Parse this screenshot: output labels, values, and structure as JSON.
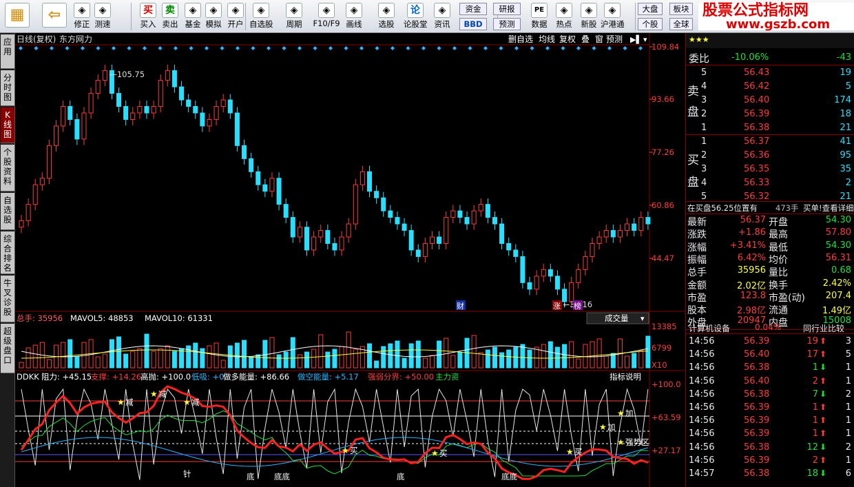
{
  "toolbar": {
    "buttons": [
      {
        "label": "修正",
        "icon": "up-arrow-icon"
      },
      {
        "label": "测速",
        "icon": "clock-icon"
      },
      {
        "label": "买入",
        "icon": "buy-icon",
        "glyph": "买"
      },
      {
        "label": "卖出",
        "icon": "sell-icon",
        "glyph": "卖"
      },
      {
        "label": "基金",
        "icon": "fund-icon"
      },
      {
        "label": "模拟",
        "icon": "hammer-icon"
      },
      {
        "label": "开户",
        "icon": "lock-icon"
      },
      {
        "label": "自选股",
        "icon": "star-icon"
      },
      {
        "label": "周期",
        "icon": "period-icon"
      },
      {
        "label": "F10/F9",
        "icon": "f10-icon"
      },
      {
        "label": "画线",
        "icon": "pen-icon"
      },
      {
        "label": "选股",
        "icon": "select-icon"
      },
      {
        "label": "论股堂",
        "icon": "forum-icon",
        "glyph": "论"
      },
      {
        "label": "资讯",
        "icon": "news-icon"
      },
      {
        "label": "数据",
        "icon": "pe-icon",
        "glyph": "PE"
      },
      {
        "label": "热点",
        "icon": "hot-icon"
      },
      {
        "label": "新股",
        "icon": "ipo-icon"
      },
      {
        "label": "沪港通",
        "icon": "sse-hkex-icon"
      }
    ],
    "mini": [
      "资金",
      "BBD",
      "研报",
      "预测",
      "大盘",
      "个股",
      "板块",
      "全球"
    ]
  },
  "logo": {
    "line1": "股票公式指标网",
    "line2": "www.gszb.com"
  },
  "sidetabs": [
    "应用",
    "分时图",
    "K线图",
    "个股资料",
    "自选股",
    "综合排名",
    "牛叉诊股",
    "超级盘口"
  ],
  "chart": {
    "title_left": "日线(复权)",
    "stock_name": "东方网力",
    "top_buttons": [
      "删自选",
      "均线",
      "复权",
      "叠",
      "窗",
      "预测"
    ],
    "price_axis": [
      "109.84",
      "93.66",
      "77.26",
      "60.86",
      "44.47"
    ],
    "high_label": "105.75",
    "low_label": "32.16",
    "tags": [
      "财",
      "涨",
      "榜"
    ],
    "vol_row": {
      "label": "总手: 35956",
      "mavol5": "MAVOL5: 48853",
      "mavol10": "MAVOL10: 61331"
    },
    "vol_select": "成交量",
    "vol_axis": [
      "13385",
      "6799",
      "X10"
    ],
    "ind_row": {
      "name": "DDKK",
      "items": [
        "阻力: +45.15",
        "支撑: +14.26",
        "高抛: +100.0",
        "低吸: +0",
        "做多能量: +86.66",
        "做空能量: +5.17",
        "强弱分界: +50.00",
        "主力资"
      ]
    },
    "ind_button": "指标说明",
    "ind_axis": [
      "+100.0",
      "+63.59",
      "+27.17"
    ],
    "signals": [
      "减",
      "减",
      "减",
      "买",
      "买",
      "加",
      "加",
      "强势区",
      "买"
    ],
    "bottom_labels": [
      "针",
      "底",
      "底底",
      "底",
      "底底"
    ]
  },
  "chart_data": {
    "type": "candlestick",
    "ylim": [
      32.16,
      109.84
    ],
    "closes": [
      57,
      62,
      68,
      70,
      80,
      86,
      92,
      88,
      82,
      90,
      96,
      100,
      103,
      96,
      92,
      88,
      90,
      92,
      90,
      92,
      100,
      103,
      98,
      94,
      92,
      90,
      86,
      88,
      92,
      94,
      90,
      80,
      76,
      72,
      68,
      66,
      70,
      62,
      58,
      52,
      55,
      48,
      52,
      54,
      50,
      48,
      52,
      56,
      68,
      72,
      66,
      64,
      60,
      58,
      56,
      54,
      48,
      46,
      50,
      52,
      50,
      58,
      60,
      58,
      56,
      60,
      62,
      58,
      56,
      50,
      48,
      46,
      38,
      36,
      40,
      42,
      40,
      36,
      32.16,
      38,
      42,
      46,
      50,
      52,
      54,
      52,
      54,
      56,
      54,
      58,
      56
    ],
    "volume_ylim": [
      0,
      13385
    ],
    "indicator_ylim": [
      0,
      100
    ]
  },
  "quote": {
    "weibi": "委比",
    "weibi_val": "-10.06%",
    "weibi_diff": "-43",
    "sell_label": [
      "卖",
      "盘"
    ],
    "buy_label": [
      "买",
      "盘"
    ],
    "sell": [
      [
        "5",
        "56.43",
        "19"
      ],
      [
        "4",
        "56.42",
        "5"
      ],
      [
        "3",
        "56.40",
        "174"
      ],
      [
        "2",
        "56.39",
        "18"
      ],
      [
        "1",
        "56.38",
        "21"
      ]
    ],
    "buy": [
      [
        "1",
        "56.37",
        "41"
      ],
      [
        "2",
        "56.36",
        "95"
      ],
      [
        "3",
        "56.35",
        "35"
      ],
      [
        "4",
        "56.33",
        "2"
      ],
      [
        "5",
        "56.32",
        "21"
      ]
    ],
    "note": "在买盘56.25位置有",
    "note_num": "473手",
    "note_link": "买单!查看详细",
    "stats": [
      [
        "最新",
        "56.37",
        "开盘",
        "54.30"
      ],
      [
        "涨跌",
        "+1.86",
        "最高",
        "57.80"
      ],
      [
        "涨幅",
        "+3.41%",
        "最低",
        "54.30"
      ],
      [
        "振幅",
        "6.42%",
        "均价",
        "56.31"
      ],
      [
        "总手",
        "35956",
        "量比",
        "0.68"
      ],
      [
        "金额",
        "2.02亿",
        "换手",
        "2.42%"
      ],
      [
        "市盈",
        "123.8",
        "市盈(动)",
        "207.4"
      ],
      [
        "股本",
        "2.98亿",
        "流通",
        "1.49亿"
      ],
      [
        "外盘",
        "20947",
        "内盘",
        "15008"
      ]
    ],
    "industry": "计算机设备",
    "industry_pct": "0.04%",
    "industry_btn": "同行业比较",
    "ticks": [
      [
        "14:56",
        "56.39",
        "19",
        "up",
        "3"
      ],
      [
        "14:56",
        "56.40",
        "17",
        "up",
        "5"
      ],
      [
        "14:56",
        "56.38",
        "1",
        "down",
        "1"
      ],
      [
        "14:56",
        "56.40",
        "2",
        "up",
        "1"
      ],
      [
        "14:56",
        "56.38",
        "7",
        "down",
        "2"
      ],
      [
        "14:56",
        "56.39",
        "1",
        "up",
        "1"
      ],
      [
        "14:56",
        "56.39",
        "1",
        "up",
        "1"
      ],
      [
        "14:56",
        "56.39",
        "1",
        "up",
        "1"
      ],
      [
        "14:56",
        "56.38",
        "12",
        "down",
        "2"
      ],
      [
        "14:56",
        "56.39",
        "2",
        "up",
        "1"
      ],
      [
        "14:57",
        "56.38",
        "18",
        "down",
        "6"
      ]
    ]
  }
}
